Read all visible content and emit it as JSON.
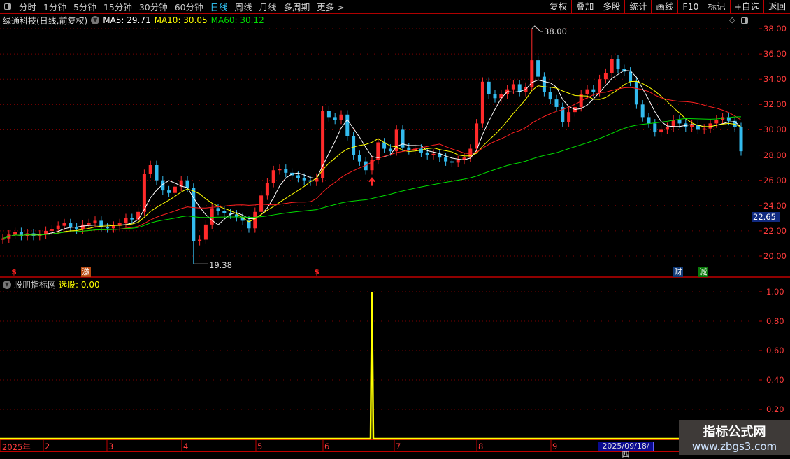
{
  "toolbar": {
    "periods": [
      "分时",
      "1分钟",
      "5分钟",
      "15分钟",
      "30分钟",
      "60分钟",
      "日线",
      "周线",
      "月线",
      "多周期",
      "更多 >"
    ],
    "active": "日线",
    "buttons": [
      "复权",
      "叠加",
      "多股",
      "统计",
      "画线",
      "F10",
      "标记",
      "+自选",
      "返回"
    ]
  },
  "header": {
    "title": "绿通科技(日线,前复权)",
    "ma5": "MA5: 29.71",
    "ma10": "MA10: 30.05",
    "ma60": "MA60: 30.12"
  },
  "colors": {
    "up": "#ff2a2a",
    "down": "#33bbee",
    "ma5": "#ffffff",
    "ma10": "#ffff00",
    "ma20": "#ff2020",
    "ma60": "#00dd00",
    "axis": "#c00000",
    "signal": "#ffff00"
  },
  "price_axis": {
    "ticks": [
      "38.00",
      "36.00",
      "34.00",
      "32.00",
      "30.00",
      "28.00",
      "26.00",
      "24.00",
      "22.00",
      "20.00"
    ],
    "current": "22.65"
  },
  "indicator": {
    "name": "股朋指标网",
    "label": "选股: 0.00",
    "ticks": [
      "1.00",
      "0.80",
      "0.60",
      "0.40",
      "0.20"
    ],
    "peaks": [
      {
        "index": 60,
        "value": 1.0
      }
    ]
  },
  "annotations": {
    "high": "38.00",
    "low": "19.38",
    "badges": [
      "$",
      "激",
      "$",
      "财",
      "减"
    ]
  },
  "time_axis": {
    "labels": [
      "2025年",
      "2",
      "3",
      "4",
      "5",
      "6",
      "7",
      "8",
      "9"
    ],
    "cursor_date": "2025/09/18/四"
  },
  "watermark": {
    "line1": "指标公式网",
    "line2": "www.zbgs3.com"
  },
  "closes": [
    21.4,
    21.7,
    21.9,
    21.6,
    21.8,
    21.6,
    21.7,
    22.0,
    22.1,
    22.4,
    22.6,
    22.3,
    22.1,
    22.5,
    22.6,
    22.8,
    22.3,
    22.2,
    22.4,
    22.6,
    23.0,
    22.9,
    23.5,
    26.5,
    27.2,
    26.0,
    25.2,
    25.0,
    25.5,
    26.0,
    25.4,
    21.2,
    21.3,
    22.5,
    23.8,
    23.6,
    23.4,
    23.3,
    23.1,
    22.8,
    22.2,
    23.5,
    24.8,
    25.8,
    26.8,
    26.9,
    26.6,
    26.4,
    26.2,
    26.0,
    25.9,
    26.2,
    31.5,
    31.0,
    30.8,
    31.2,
    29.5,
    28.0,
    27.5,
    26.8,
    27.6,
    29.0,
    28.5,
    28.3,
    30.0,
    28.6,
    28.4,
    28.5,
    28.2,
    28.0,
    28.1,
    27.8,
    27.5,
    27.4,
    27.6,
    27.8,
    28.5,
    30.5,
    33.8,
    32.8,
    32.5,
    32.8,
    33.2,
    33.6,
    33.0,
    33.4,
    35.5,
    34.2,
    33.0,
    32.4,
    31.8,
    30.6,
    31.4,
    31.8,
    32.8,
    33.2,
    33.0,
    34.0,
    34.5,
    35.6,
    34.8,
    34.6,
    33.8,
    32.0,
    31.0,
    30.5,
    29.8,
    30.0,
    30.2,
    30.8,
    30.5,
    30.2,
    30.4,
    30.0,
    30.1,
    30.5,
    30.8,
    31.0,
    30.7,
    30.2,
    28.3
  ]
}
